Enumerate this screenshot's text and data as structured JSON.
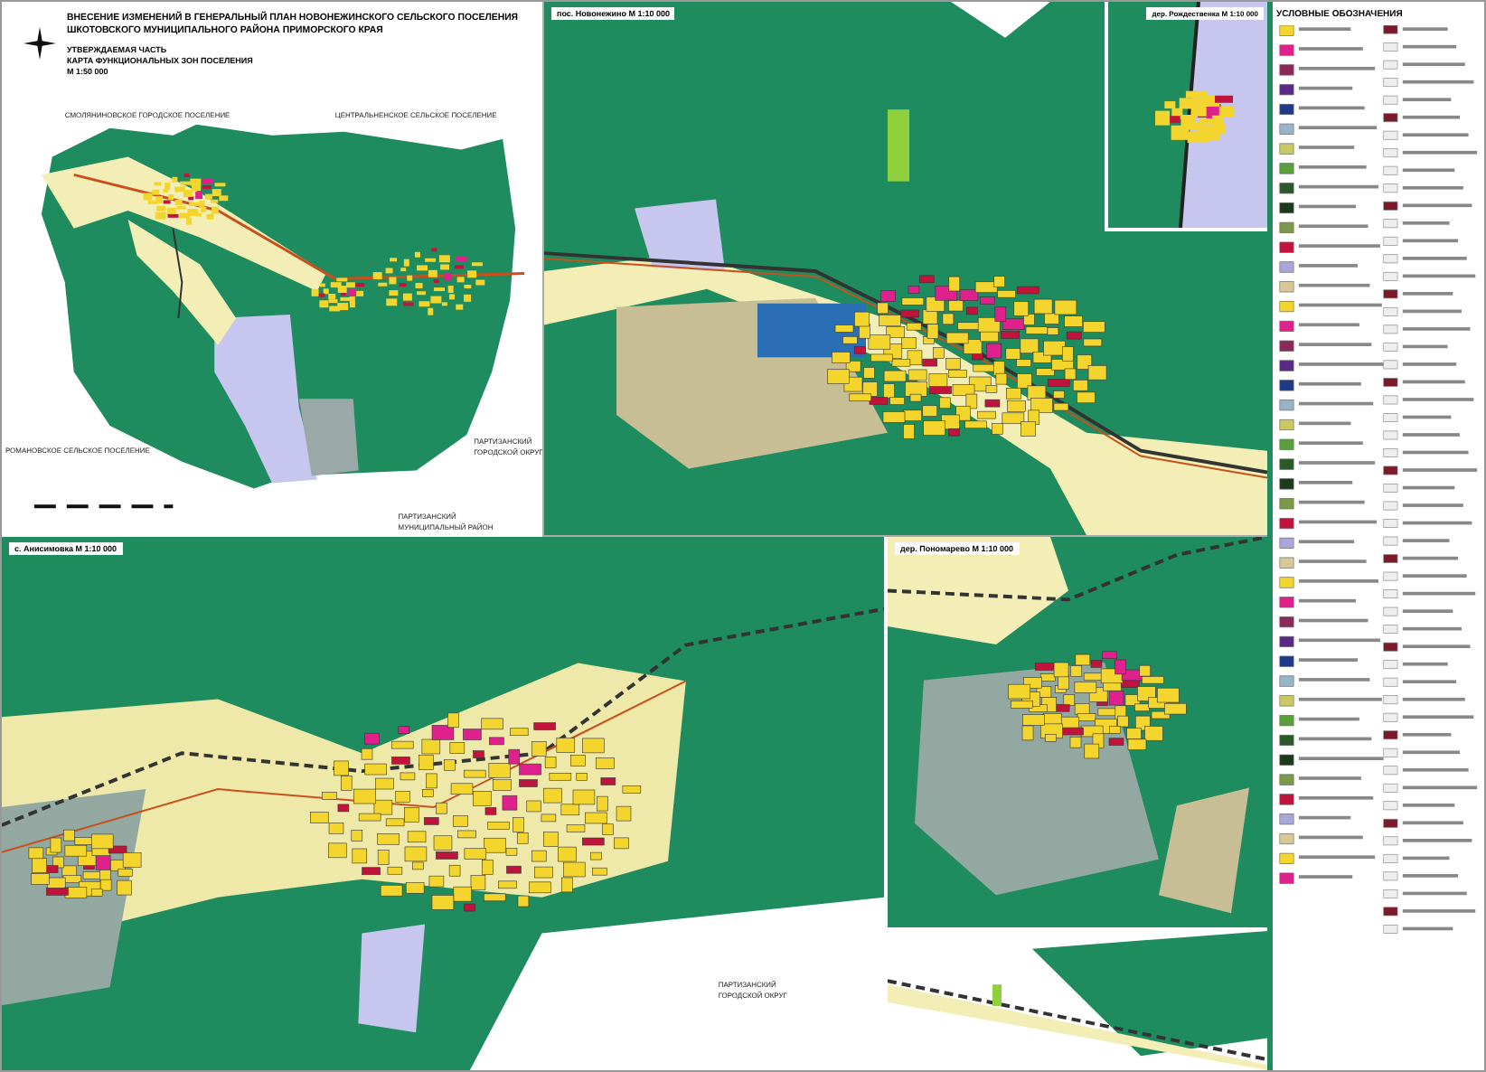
{
  "header": {
    "title_lines": [
      "ВНЕСЕНИЕ ИЗМЕНЕНИЙ В ГЕНЕРАЛЬНЫЙ ПЛАН НОВОНЕЖИНСКОГО СЕЛЬСКОГО ПОСЕЛЕНИЯ",
      "ШКОТОВСКОГО МУНИЦИПАЛЬНОГО РАЙОНА ПРИМОРСКОГО КРАЯ"
    ],
    "part": "УТВЕРЖДАЕМАЯ ЧАСТЬ",
    "sheet": "КАРТА ФУНКЦИОНАЛЬНЫХ ЗОН ПОСЕЛЕНИЯ",
    "scale": "М 1:50 000"
  },
  "overview_map": {
    "labels": [
      {
        "lines": [
          "СМОЛЯНИНОВСКОЕ ГОРОДСКОЕ ПОСЕЛЕНИЕ"
        ]
      },
      {
        "lines": [
          "ЦЕНТРАЛЬНЕНСКОЕ СЕЛЬСКОЕ ПОСЕЛЕНИЕ"
        ]
      },
      {
        "lines": [
          "РОМАНОВСКОЕ СЕЛЬСКОЕ ПОСЕЛЕНИЕ"
        ]
      },
      {
        "lines": [
          "ПАРТИЗАНСКИЙ",
          "ГОРОДСКОЙ ОКРУГ"
        ]
      },
      {
        "lines": [
          "ПАРТИЗАНСКИЙ",
          "МУНИЦИПАЛЬНЫЙ РАЙОН"
        ]
      }
    ]
  },
  "main_map": {
    "title": "пос. Новонежино М 1:10 000"
  },
  "inset_map": {
    "title": "дер. Рождественка М 1:10 000"
  },
  "bottom_left_map": {
    "title": "с. Анисимовка М 1:10 000",
    "labels": [
      {
        "lines": [
          "ПАРТИЗАНСКИЙ",
          "ГОРОДСКОЙ ОКРУГ"
        ]
      }
    ]
  },
  "bottom_right_map": {
    "title": "дер. Пономарево М 1:10 000"
  },
  "legend": {
    "heading": "УСЛОВНЫЕ ОБОЗНАЧЕНИЯ"
  }
}
